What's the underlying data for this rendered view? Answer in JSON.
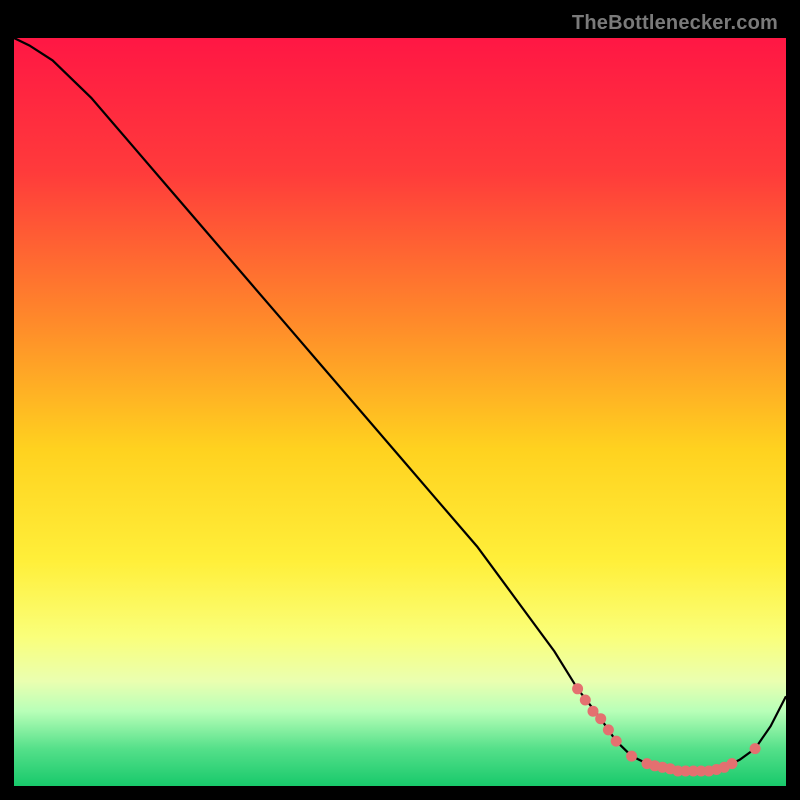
{
  "watermark": "TheBottlenecker.com",
  "colors": {
    "bg": "#000000",
    "curve": "#000000",
    "dots": "#e47070",
    "gradient_stops": [
      {
        "offset": 0.0,
        "color": "#ff1744"
      },
      {
        "offset": 0.18,
        "color": "#ff3b3b"
      },
      {
        "offset": 0.38,
        "color": "#ff8a2a"
      },
      {
        "offset": 0.55,
        "color": "#ffd21f"
      },
      {
        "offset": 0.7,
        "color": "#ffef3a"
      },
      {
        "offset": 0.8,
        "color": "#faff7a"
      },
      {
        "offset": 0.86,
        "color": "#eaffb0"
      },
      {
        "offset": 0.9,
        "color": "#b8ffb8"
      },
      {
        "offset": 0.95,
        "color": "#55e08a"
      },
      {
        "offset": 1.0,
        "color": "#18c96b"
      }
    ]
  },
  "chart_data": {
    "type": "line",
    "title": "",
    "xlabel": "",
    "ylabel": "",
    "xlim": [
      0,
      100
    ],
    "ylim": [
      0,
      100
    ],
    "categories": [
      0,
      2,
      5,
      10,
      15,
      20,
      25,
      30,
      35,
      40,
      45,
      50,
      55,
      60,
      65,
      70,
      73,
      76,
      78,
      80,
      82,
      84,
      86,
      88,
      90,
      92,
      94,
      96,
      98,
      100
    ],
    "series": [
      {
        "name": "bottleneck-curve",
        "values": [
          100,
          99,
          97,
          92,
          86,
          80,
          74,
          68,
          62,
          56,
          50,
          44,
          38,
          32,
          25,
          18,
          13,
          9,
          6,
          4,
          3,
          2.5,
          2,
          2,
          2,
          2.5,
          3.5,
          5,
          8,
          12
        ]
      }
    ],
    "markers": {
      "name": "highlight-dots",
      "points": [
        {
          "x": 73,
          "y": 13
        },
        {
          "x": 74,
          "y": 11.5
        },
        {
          "x": 75,
          "y": 10
        },
        {
          "x": 76,
          "y": 9
        },
        {
          "x": 77,
          "y": 7.5
        },
        {
          "x": 78,
          "y": 6
        },
        {
          "x": 80,
          "y": 4
        },
        {
          "x": 82,
          "y": 3
        },
        {
          "x": 83,
          "y": 2.7
        },
        {
          "x": 84,
          "y": 2.5
        },
        {
          "x": 85,
          "y": 2.3
        },
        {
          "x": 86,
          "y": 2
        },
        {
          "x": 87,
          "y": 2
        },
        {
          "x": 88,
          "y": 2
        },
        {
          "x": 89,
          "y": 2
        },
        {
          "x": 90,
          "y": 2
        },
        {
          "x": 91,
          "y": 2.2
        },
        {
          "x": 92,
          "y": 2.5
        },
        {
          "x": 93,
          "y": 3
        },
        {
          "x": 96,
          "y": 5
        }
      ]
    }
  }
}
